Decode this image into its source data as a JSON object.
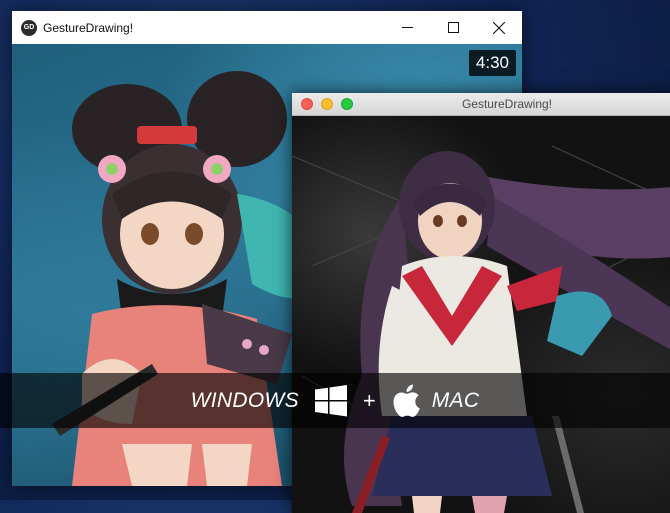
{
  "windows_app": {
    "title": "GestureDrawing!",
    "icon_text": "GD",
    "timer": "4:30",
    "controls": [
      "minimize-icon",
      "maximize-icon",
      "close-icon"
    ]
  },
  "mac_app": {
    "title": "GestureDrawing!",
    "controls": [
      "close",
      "minimize",
      "zoom"
    ]
  },
  "banner": {
    "windows_label": "WINDOWS",
    "plus": "+",
    "mac_label": "MAC",
    "icons": [
      "windows-logo-icon",
      "apple-logo-icon"
    ]
  },
  "colors": {
    "desktop": "#102656",
    "mac_close": "#fc5f57",
    "mac_min": "#fdbc2e",
    "mac_max": "#2ac840"
  }
}
